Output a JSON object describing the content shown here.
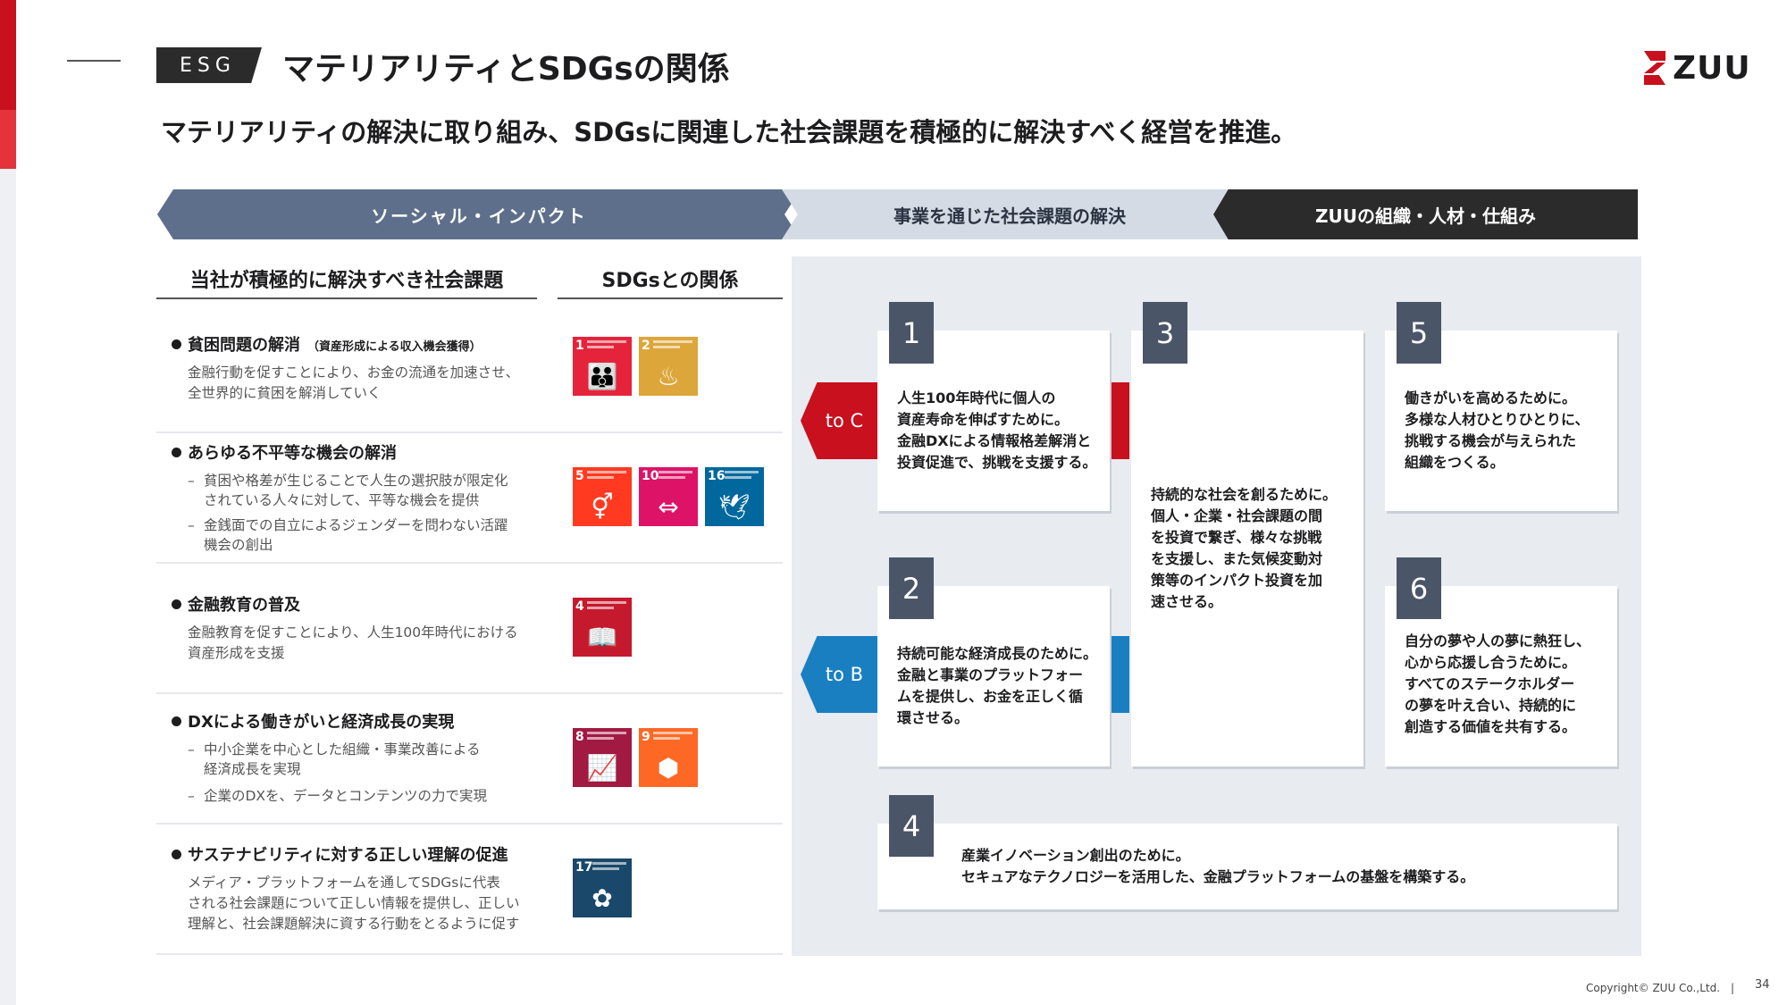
{
  "header": {
    "badge": "ESG",
    "title": "マテリアリティとSDGsの関係",
    "subtitle": "マテリアリティの解決に取り組み、SDGsに関連した社会課題を積極的に解決すべく経営を推進。",
    "logo_text": "ZUU"
  },
  "banner": {
    "social": "ソーシャル・インパクト",
    "business": "事業を通じた社会課題の解決",
    "org": "ZUUの組織・人材・仕組み"
  },
  "columns": {
    "issues": "当社が積極的に解決すべき社会課題",
    "sdgs": "SDGsとの関係"
  },
  "issues": [
    {
      "title": "貧困問題の解消",
      "note": "（資産形成による収入機会獲得）",
      "desc": [
        "金融行動を促すことにより、お金の流通を加速させ、",
        "全世界的に貧困を解消していく"
      ],
      "sdgs": [
        {
          "num": "1",
          "icon": "people-icon",
          "glyph": "👪",
          "color": "#e5243b"
        },
        {
          "num": "2",
          "icon": "bowl-icon",
          "glyph": "♨",
          "color": "#dda63a"
        }
      ]
    },
    {
      "title": "あらゆる不平等な機会の解消",
      "bullets": [
        [
          "貧困や格差が生じることで人生の選択肢が限定化",
          "されている人々に対して、平等な機会を提供"
        ],
        [
          "金銭面での自立によるジェンダーを問わない活躍",
          "機会の創出"
        ]
      ],
      "sdgs": [
        {
          "num": "5",
          "icon": "gender-icon",
          "glyph": "⚥",
          "color": "#ff3a21"
        },
        {
          "num": "10",
          "icon": "equality-icon",
          "glyph": "⇔",
          "color": "#dd1367"
        },
        {
          "num": "16",
          "icon": "dove-icon",
          "glyph": "🕊",
          "color": "#00689d"
        }
      ]
    },
    {
      "title": "金融教育の普及",
      "desc": [
        "金融教育を促すことにより、人生100年時代における",
        "資産形成を支援"
      ],
      "sdgs": [
        {
          "num": "4",
          "icon": "book-icon",
          "glyph": "📖",
          "color": "#c5192d"
        }
      ]
    },
    {
      "title": "DXによる働きがいと経済成長の実現",
      "bullets": [
        [
          "中小企業を中心とした組織・事業改善による",
          "経済成長を実現"
        ],
        [
          "企業のDXを、データとコンテンツの力で実現"
        ]
      ],
      "sdgs": [
        {
          "num": "8",
          "icon": "growth-chart-icon",
          "glyph": "📈",
          "color": "#a21942"
        },
        {
          "num": "9",
          "icon": "cubes-icon",
          "glyph": "⬢",
          "color": "#fd6925"
        }
      ]
    },
    {
      "title": "サステナビリティに対する正しい理解の促進",
      "desc": [
        "メディア・プラットフォームを通してSDGsに代表",
        "される社会課題について正しい情報を提供し、正しい",
        "理解と、社会課題解決に資する行動をとるように促す"
      ],
      "sdgs": [
        {
          "num": "17",
          "icon": "flower-icon",
          "glyph": "✿",
          "color": "#19486a"
        }
      ]
    }
  ],
  "tags": {
    "c": "to C",
    "b": "to B"
  },
  "cards": [
    {
      "num": "1",
      "lines": [
        "人生100年時代に個人の",
        "資産寿命を伸ばすために。",
        "金融DXによる情報格差解消と",
        "投資促進で、挑戦を支援する。"
      ]
    },
    {
      "num": "2",
      "lines": [
        "持続可能な経済成長のために。",
        "金融と事業のプラットフォー",
        "ムを提供し、お金を正しく循",
        "環させる。"
      ]
    },
    {
      "num": "3",
      "lines": [
        "持続的な社会を創るために。",
        "個人・企業・社会課題の間",
        "を投資で繋ぎ、様々な挑戦",
        "を支援し、また気候変動対",
        "策等のインパクト投資を加",
        "速させる。"
      ]
    },
    {
      "num": "4",
      "lines": [
        "産業イノベーション創出のために。",
        "セキュアなテクノロジーを活用した、金融プラットフォームの基盤を構築する。"
      ]
    },
    {
      "num": "5",
      "lines": [
        "働きがいを高めるために。",
        "多様な人材ひとりひとりに、",
        "挑戦する機会が与えられた",
        "組織をつくる。"
      ]
    },
    {
      "num": "6",
      "lines": [
        "自分の夢や人の夢に熱狂し、",
        "心から応援し合うために。",
        "すべてのステークホルダー",
        "の夢を叶え合い、持続的に",
        "創造する価値を共有する。"
      ]
    }
  ],
  "footer": {
    "copyright": "Copyright© ZUU Co.,Ltd.　|",
    "page": "34"
  }
}
